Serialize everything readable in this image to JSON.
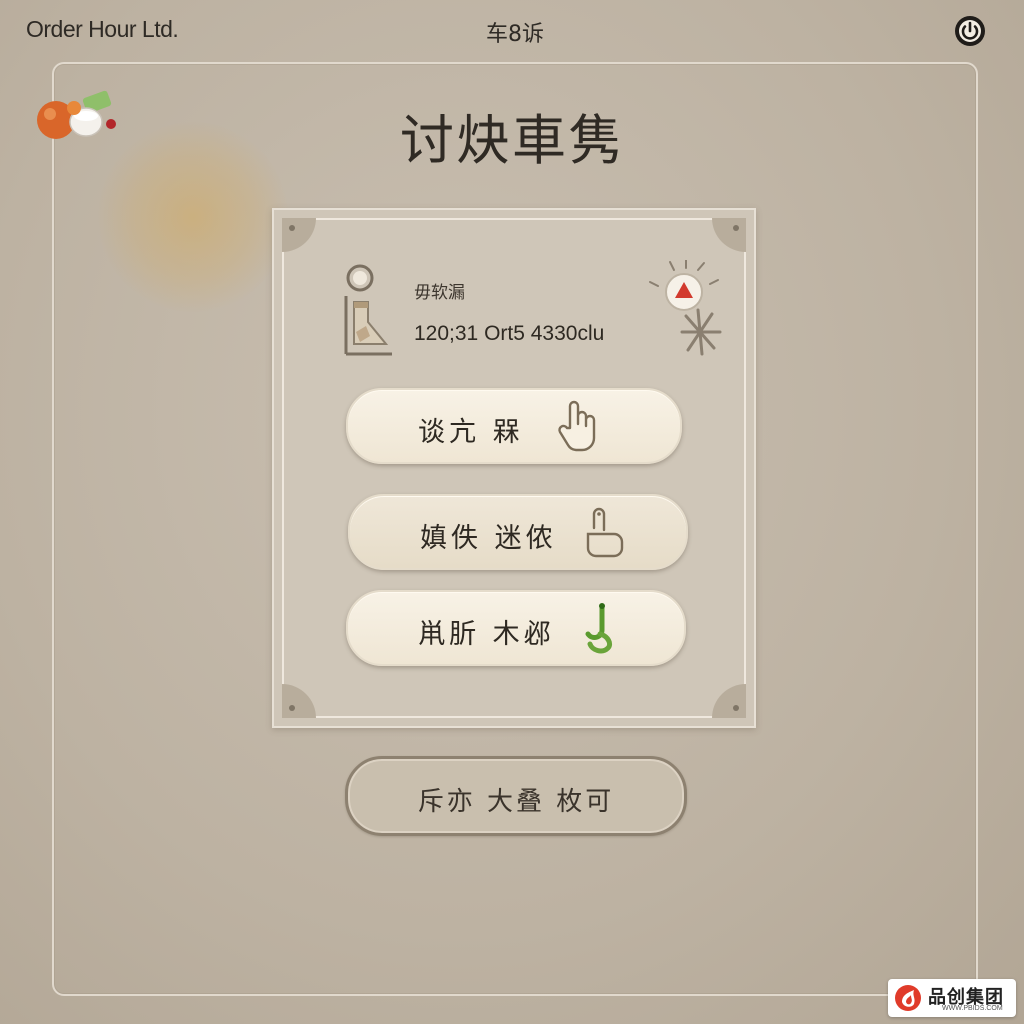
{
  "header": {
    "brand": "Order Hour Ltd.",
    "center_text": "车8诉",
    "power_icon": "power-icon"
  },
  "page": {
    "title": "讨炔車隽"
  },
  "status_card": {
    "label": "毋软漏",
    "value": "120;31 Ort5 4330clu",
    "left_icon": "kettle-icon",
    "right_icon": "alert-sparkle-icon"
  },
  "actions": [
    {
      "label": "谈亢 槑",
      "icon": "hand-pointer-icon"
    },
    {
      "label": "嫃佚 迷侬",
      "icon": "finger-touch-icon"
    },
    {
      "label": "鼡肵 木邲",
      "icon": "green-hook-icon"
    }
  ],
  "secondary_action": {
    "label": "斥亦 大叠 枚可"
  },
  "watermark": {
    "text": "品创集团",
    "url": "WWW.PBIDS.COM"
  },
  "colors": {
    "background": "#bdb2a2",
    "panel": "#cfc6b8",
    "button": "#f5eee0",
    "accent_green": "#6aa43a",
    "accent_red": "#d23a2e"
  }
}
